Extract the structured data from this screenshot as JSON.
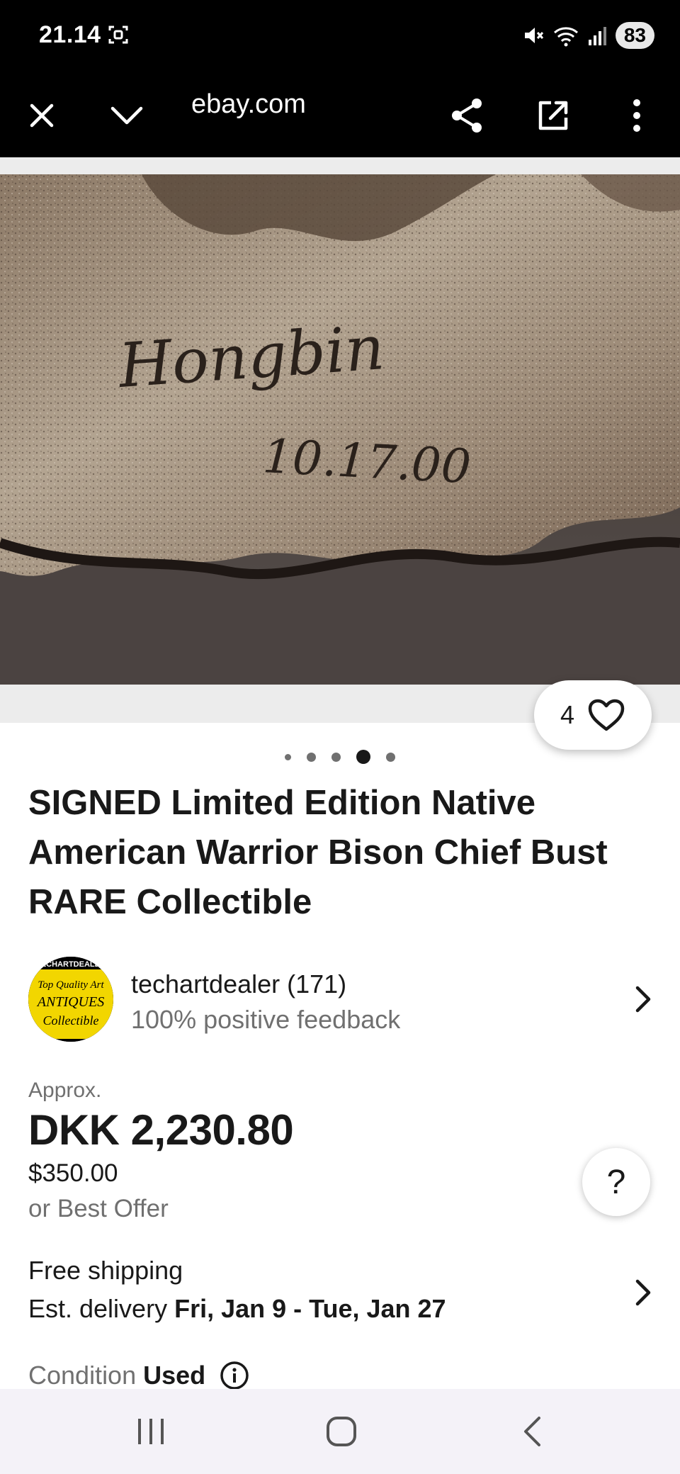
{
  "status_bar": {
    "time": "21.14",
    "battery": "83"
  },
  "browser": {
    "url": "ebay.com"
  },
  "gallery": {
    "signature_lines": [
      "Hongbin",
      "10.17.00"
    ],
    "watch_count": "4",
    "dot_count": 5,
    "active_dot": 3
  },
  "listing": {
    "title": "SIGNED Limited Edition Native American Warrior Bison Chief Bust RARE Collectible",
    "seller": {
      "name": "techartdealer (171)",
      "feedback": "100% positive feedback",
      "avatar_text": [
        "TECHARTDEALER",
        "Top Quality Art",
        "ANTIQUES",
        "Collectible"
      ]
    },
    "price": {
      "approx_label": "Approx.",
      "converted": "DKK 2,230.80",
      "original": "$350.00",
      "best_offer": "or Best Offer"
    },
    "shipping": {
      "title": "Free shipping",
      "est_label": "Est. delivery",
      "est_dates": "Fri, Jan 9 - Tue, Jan 27"
    },
    "condition": {
      "label": "Condition",
      "value": "Used"
    },
    "help_label": "?"
  },
  "colors": {
    "text": "#191919",
    "secondary": "#707070",
    "bar": "#000000",
    "nav_bg": "#f4f2f8"
  }
}
